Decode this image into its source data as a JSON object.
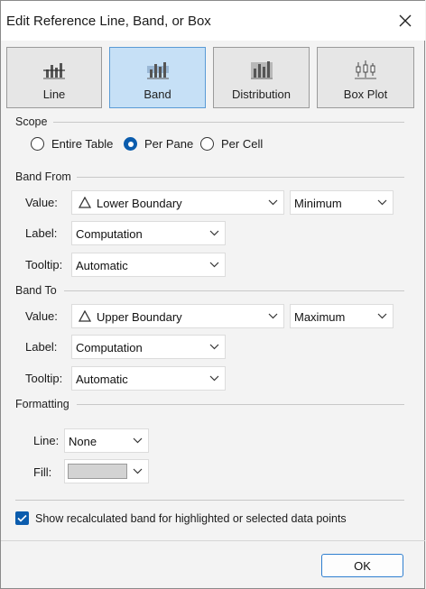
{
  "window": {
    "title": "Edit Reference Line, Band, or Box"
  },
  "types": [
    {
      "label": "Line",
      "icon": "reference-line-icon"
    },
    {
      "label": "Band",
      "icon": "reference-band-icon"
    },
    {
      "label": "Distribution",
      "icon": "distribution-icon"
    },
    {
      "label": "Box Plot",
      "icon": "box-plot-icon"
    }
  ],
  "selected_type": "Band",
  "scope": {
    "heading": "Scope",
    "options": [
      "Entire Table",
      "Per Pane",
      "Per Cell"
    ],
    "selected": "Per Pane"
  },
  "band_from": {
    "heading": "Band From",
    "value_label": "Value:",
    "value": "Lower Boundary",
    "aggregation": "Minimum",
    "label_label": "Label:",
    "label_value": "Computation",
    "tooltip_label": "Tooltip:",
    "tooltip_value": "Automatic"
  },
  "band_to": {
    "heading": "Band To",
    "value_label": "Value:",
    "value": "Upper Boundary",
    "aggregation": "Maximum",
    "label_label": "Label:",
    "label_value": "Computation",
    "tooltip_label": "Tooltip:",
    "tooltip_value": "Automatic"
  },
  "formatting": {
    "heading": "Formatting",
    "line_label": "Line:",
    "line_value": "None",
    "fill_label": "Fill:",
    "fill_color": "#d3d3d3"
  },
  "recalc": {
    "label": "Show recalculated band for highlighted or selected data points",
    "checked": true
  },
  "buttons": {
    "ok": "OK"
  },
  "colors": {
    "accent": "#0b5cad",
    "selected_tab": "#c6e0f6",
    "selected_border": "#5a9bd5"
  }
}
